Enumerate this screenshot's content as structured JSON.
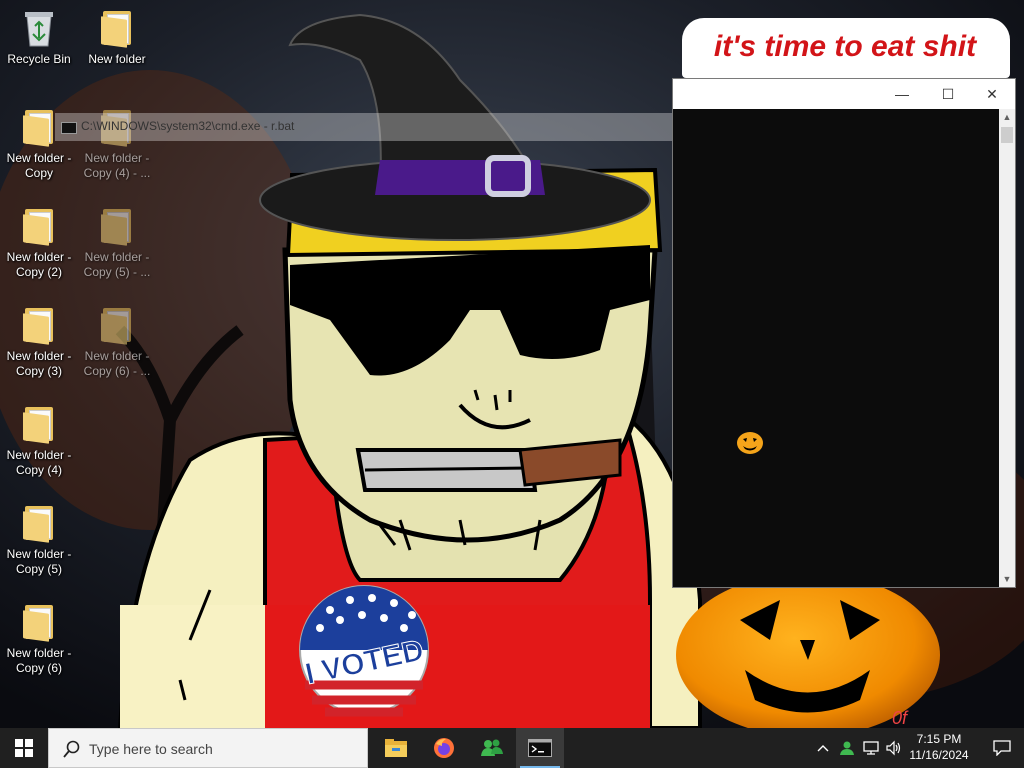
{
  "wallpaper": {
    "caption": "it's time to eat shit",
    "badge_text": "I VOTED",
    "corner_mark": "0f"
  },
  "desktop_icons": [
    {
      "label": "Recycle Bin",
      "icon": "recycle-bin-icon",
      "dim": false
    },
    {
      "label": "New folder",
      "icon": "folder-icon",
      "dim": false
    },
    {
      "label": "New folder -\nCopy",
      "icon": "folder-icon",
      "dim": false
    },
    {
      "label": "New folder -\nCopy (4) - ...",
      "icon": "folder-icon",
      "dim": true
    },
    {
      "label": "New folder -\nCopy (2)",
      "icon": "folder-icon",
      "dim": false
    },
    {
      "label": "New folder -\nCopy (5) - ...",
      "icon": "folder-icon",
      "dim": true
    },
    {
      "label": "New folder -\nCopy (3)",
      "icon": "folder-icon",
      "dim": false
    },
    {
      "label": "New folder -\nCopy (6) - ...",
      "icon": "folder-icon",
      "dim": true
    },
    {
      "label": "New folder -\nCopy (4)",
      "icon": "folder-icon",
      "dim": false
    },
    {
      "label": "New folder -\nCopy (5)",
      "icon": "folder-icon",
      "dim": false
    },
    {
      "label": "New folder -\nCopy (6)",
      "icon": "folder-icon",
      "dim": false
    }
  ],
  "ghost_window": {
    "title": "C:\\WINDOWS\\system32\\cmd.exe - r.bat"
  },
  "console_window": {
    "minimize": "—",
    "maximize": "☐",
    "close": "✕",
    "content_icon": "pumpkin-icon"
  },
  "taskbar": {
    "search_placeholder": "Type here to search",
    "apps": [
      {
        "name": "file-explorer",
        "icon": "folder-icon",
        "active": false
      },
      {
        "name": "firefox",
        "icon": "firefox-icon",
        "active": false
      },
      {
        "name": "people",
        "icon": "people-icon",
        "active": false
      },
      {
        "name": "command-prompt",
        "icon": "terminal-icon",
        "active": true
      }
    ],
    "tray": [
      "chevron-up-icon",
      "user-icon",
      "network-icon",
      "volume-icon"
    ],
    "time": "7:15 PM",
    "date": "11/16/2024",
    "colors": {
      "taskbar": "#202020",
      "accent": "#76b9ed"
    }
  }
}
